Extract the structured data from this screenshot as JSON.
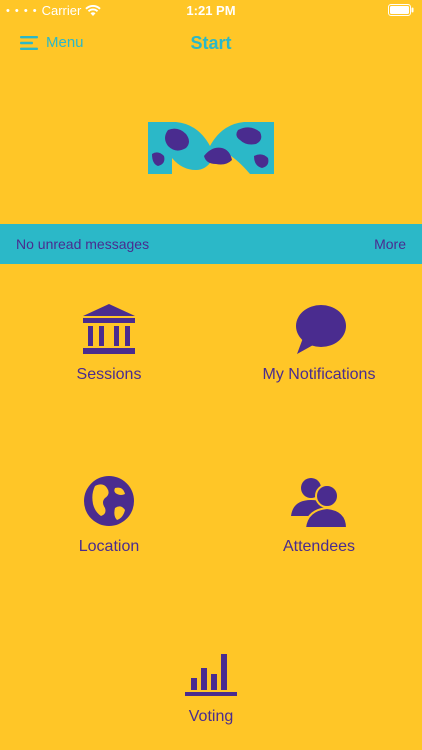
{
  "status_bar": {
    "carrier": "Carrier",
    "time": "1:21 PM"
  },
  "nav": {
    "menu_label": "Menu",
    "title": "Start"
  },
  "messages": {
    "text": "No unread messages",
    "more_label": "More"
  },
  "tiles": [
    {
      "label": "Sessions",
      "icon": "building-icon"
    },
    {
      "label": "My Notifications",
      "icon": "speech-bubble-icon"
    },
    {
      "label": "Location",
      "icon": "globe-icon"
    },
    {
      "label": "Attendees",
      "icon": "people-icon"
    },
    {
      "label": "Voting",
      "icon": "bar-chart-icon"
    }
  ],
  "colors": {
    "background": "#FFC627",
    "accent": "#2BB8C8",
    "primary": "#4A2C8F"
  }
}
